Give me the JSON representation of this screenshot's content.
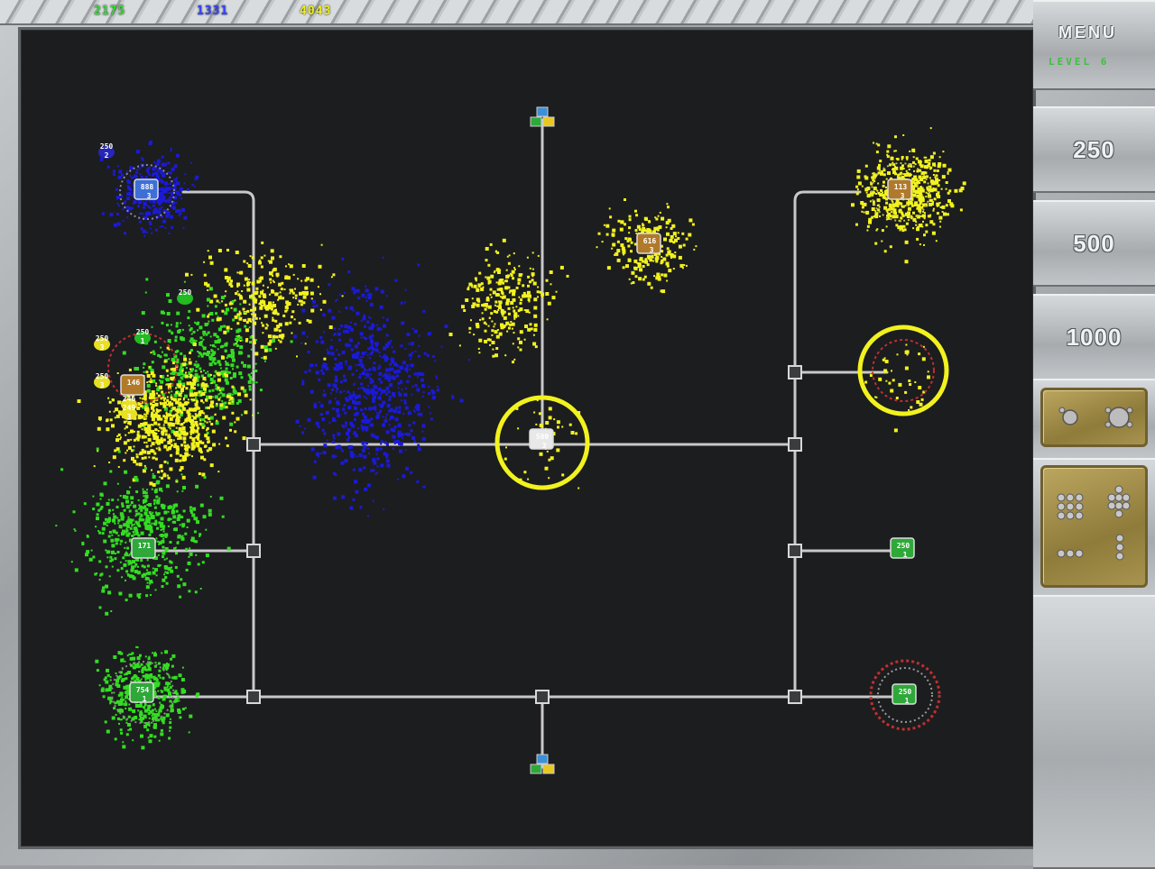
{
  "scores": [
    {
      "value": "2175",
      "color": "#33dd33"
    },
    {
      "value": "1331",
      "color": "#3344ff"
    },
    {
      "value": "4043",
      "color": "#eeee22"
    }
  ],
  "menu": {
    "label": "MENU",
    "level": "LEVEL 6"
  },
  "send_buttons": [
    "250",
    "500",
    "1000"
  ],
  "colors": {
    "green": "#33dd22",
    "blue": "#1a1ad8",
    "yellow": "#f2f21e",
    "pipe": "#c8c8c8",
    "board": "#1c1d1f"
  },
  "nodes": [
    {
      "id": "blue-base",
      "label": "888",
      "sub": "3",
      "owner": "blue"
    },
    {
      "id": "yellow-top-right",
      "label": "113",
      "sub": "3",
      "owner": "yellow"
    },
    {
      "id": "yellow-small",
      "label": "616",
      "sub": "3",
      "owner": "yellow"
    },
    {
      "id": "center",
      "label": "500",
      "sub": "3",
      "owner": "neutral"
    },
    {
      "id": "green-mid",
      "label": "171",
      "sub": "",
      "owner": "green"
    },
    {
      "id": "green-bottom",
      "label": "754",
      "sub": "1",
      "owner": "green"
    },
    {
      "id": "right-250",
      "label": "250",
      "sub": "1",
      "owner": "green"
    },
    {
      "id": "right-bottom",
      "label": "250",
      "sub": "1",
      "owner": "green"
    },
    {
      "id": "contested",
      "label": "146",
      "sub": "",
      "owner": "yellow"
    }
  ],
  "floating_labels": [
    {
      "text": "250",
      "sub": "2",
      "color": "blue"
    },
    {
      "text": "250",
      "sub": "",
      "color": "green"
    },
    {
      "text": "250",
      "sub": "1",
      "color": "green"
    },
    {
      "text": "250",
      "sub": "3",
      "color": "yellow"
    },
    {
      "text": "250",
      "sub": "3",
      "color": "yellow"
    },
    {
      "text": "246",
      "sub": "",
      "color": "yellow"
    },
    {
      "text": "249",
      "sub": "3",
      "color": "yellow"
    }
  ]
}
